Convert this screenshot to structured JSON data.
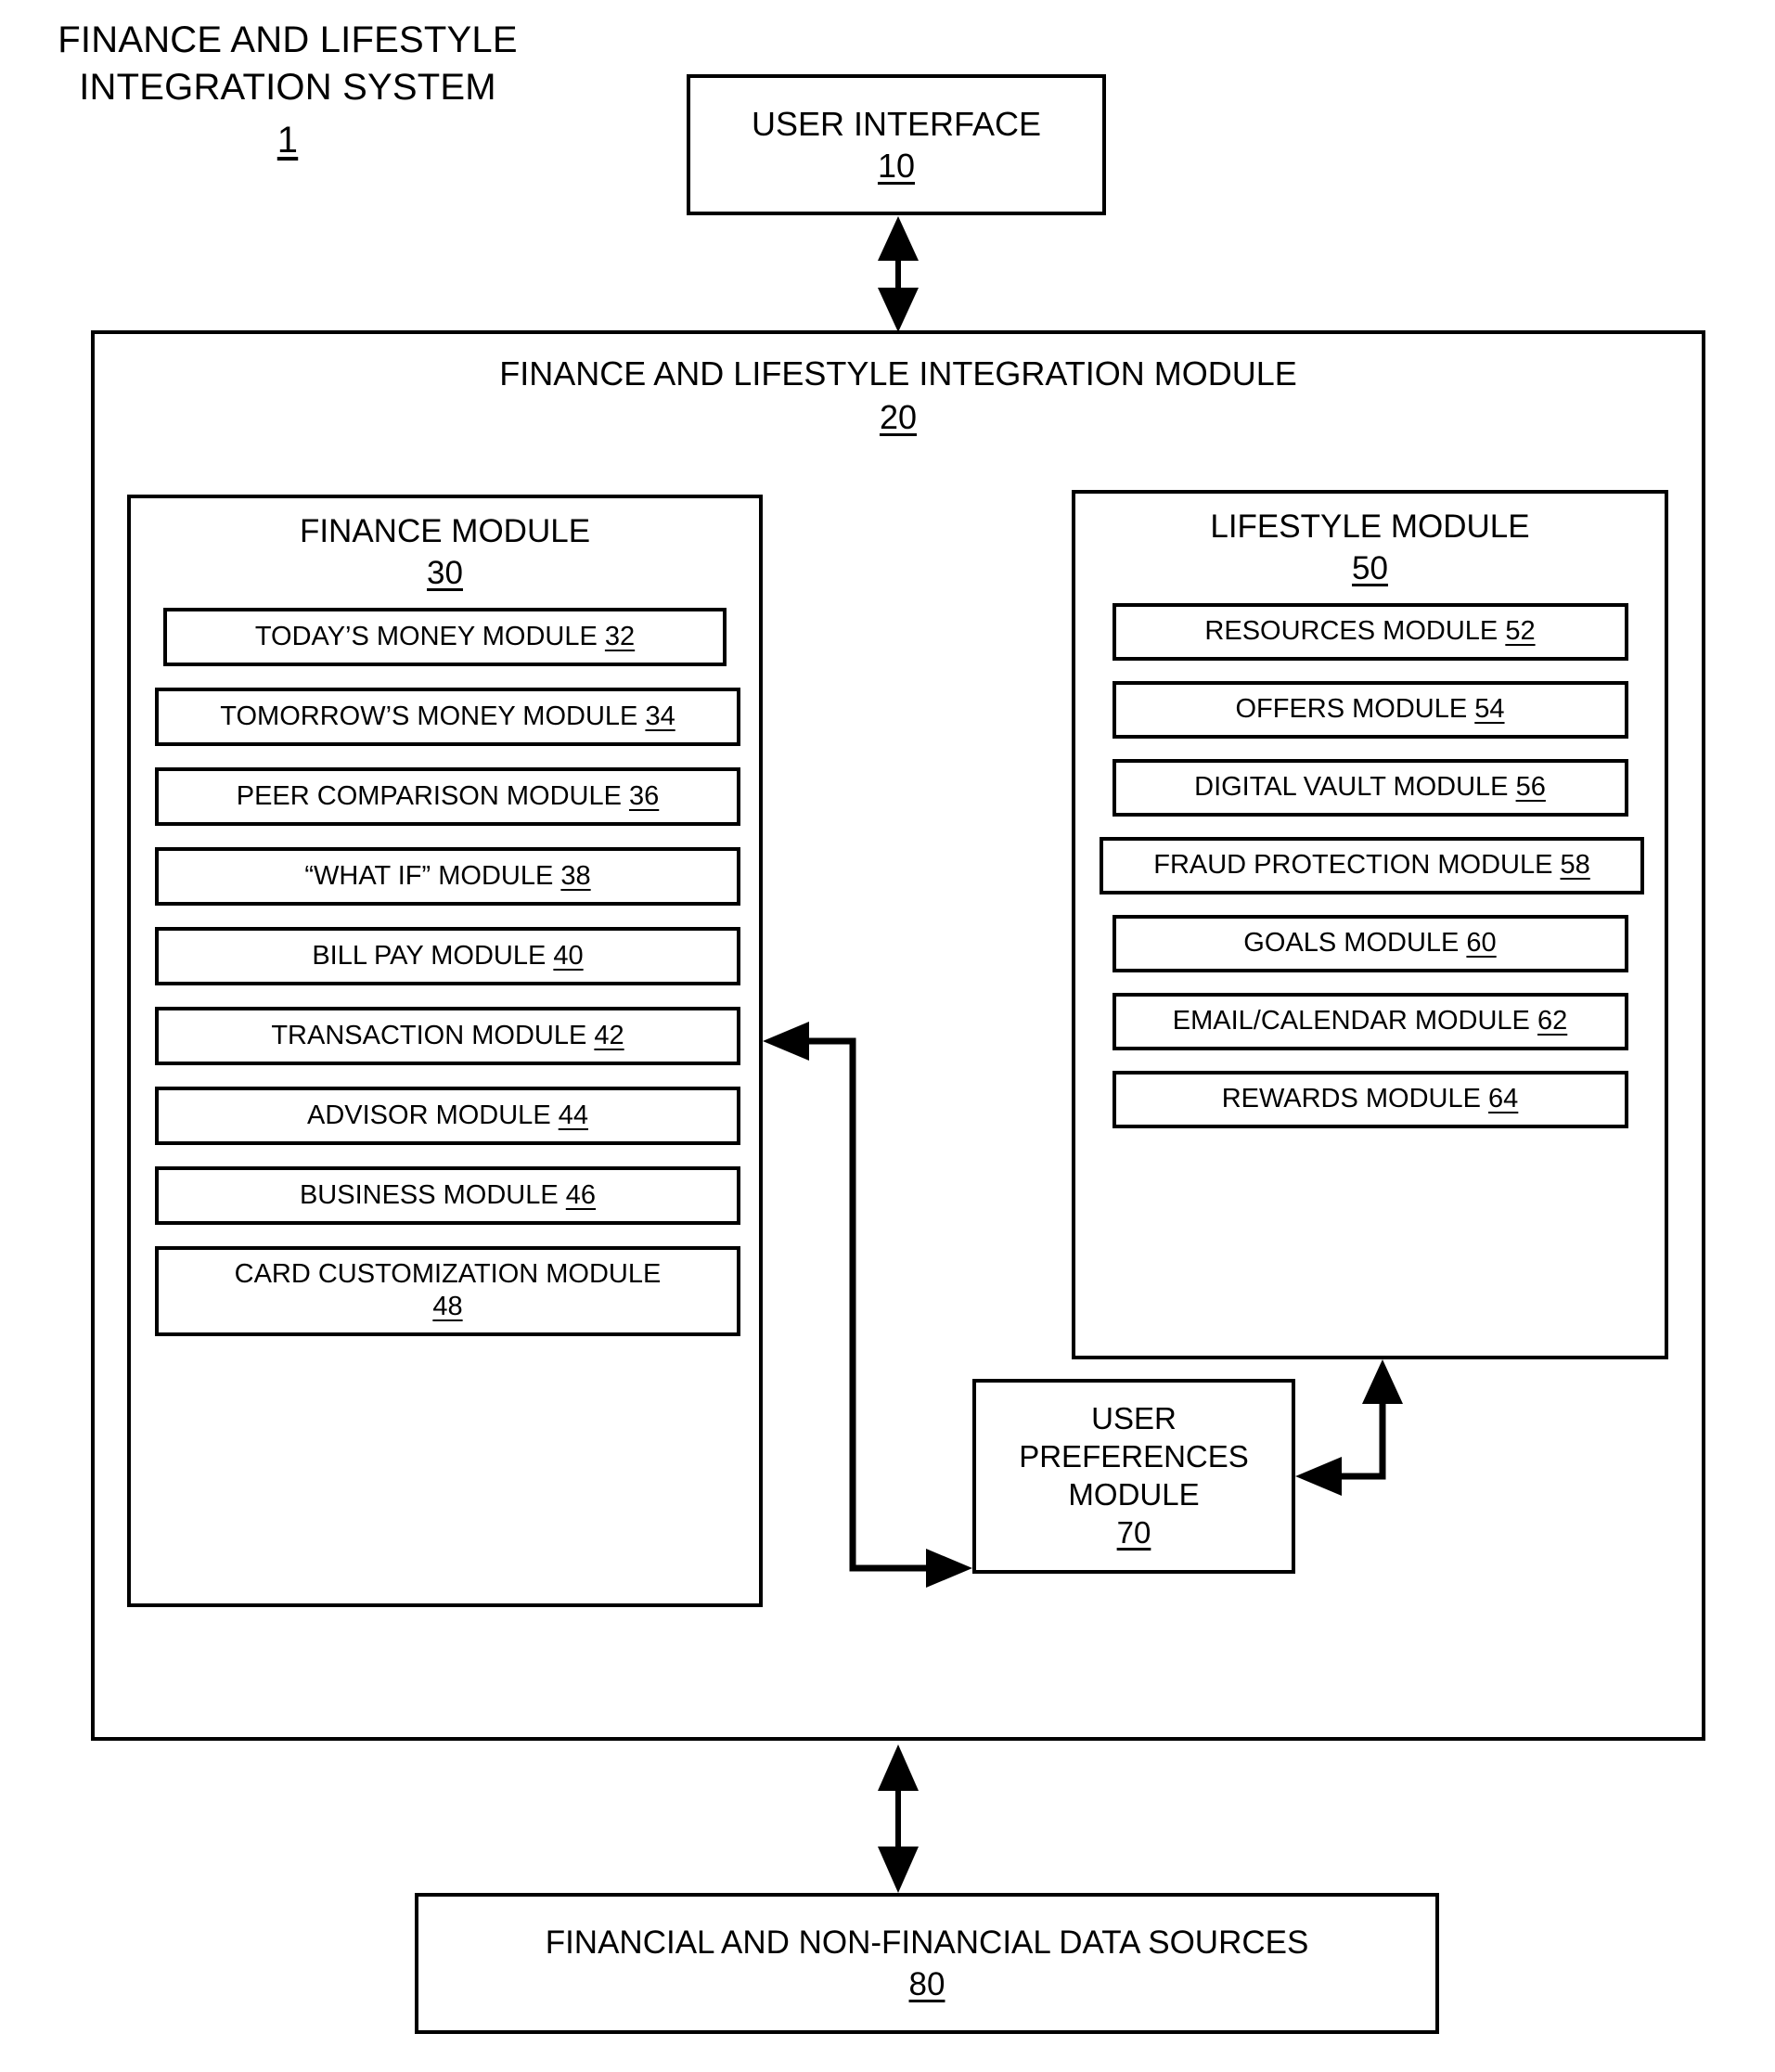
{
  "figure": {
    "title_line1": "FINANCE AND LIFESTYLE",
    "title_line2": "INTEGRATION SYSTEM",
    "title_ref": "1"
  },
  "user_interface": {
    "label": "USER INTERFACE",
    "ref": "10"
  },
  "integration_module": {
    "label": "FINANCE AND LIFESTYLE INTEGRATION MODULE",
    "ref": "20"
  },
  "finance_module": {
    "label": "FINANCE MODULE",
    "ref": "30",
    "items": [
      {
        "label": "TODAY’S MONEY MODULE",
        "ref": "32"
      },
      {
        "label": "TOMORROW’S MONEY MODULE",
        "ref": "34"
      },
      {
        "label": "PEER COMPARISON MODULE",
        "ref": "36"
      },
      {
        "label": "“WHAT IF” MODULE",
        "ref": "38"
      },
      {
        "label": "BILL PAY MODULE",
        "ref": "40"
      },
      {
        "label": "TRANSACTION MODULE",
        "ref": "42"
      },
      {
        "label": "ADVISOR MODULE",
        "ref": "44"
      },
      {
        "label": "BUSINESS MODULE",
        "ref": "46"
      },
      {
        "label": "CARD CUSTOMIZATION MODULE",
        "ref": "48"
      }
    ]
  },
  "lifestyle_module": {
    "label": "LIFESTYLE MODULE",
    "ref": "50",
    "items": [
      {
        "label": "RESOURCES MODULE",
        "ref": "52"
      },
      {
        "label": "OFFERS MODULE",
        "ref": "54"
      },
      {
        "label": "DIGITAL VAULT MODULE",
        "ref": "56"
      },
      {
        "label": "FRAUD PROTECTION MODULE",
        "ref": "58"
      },
      {
        "label": "GOALS MODULE",
        "ref": "60"
      },
      {
        "label": "EMAIL/CALENDAR MODULE",
        "ref": "62"
      },
      {
        "label": "REWARDS MODULE",
        "ref": "64"
      }
    ]
  },
  "user_preferences": {
    "line1": "USER",
    "line2": "PREFERENCES",
    "line3": "MODULE",
    "ref": "70"
  },
  "data_sources": {
    "label": "FINANCIAL AND NON-FINANCIAL DATA SOURCES",
    "ref": "80"
  },
  "colors": {
    "stroke": "#000000",
    "background": "#ffffff"
  }
}
